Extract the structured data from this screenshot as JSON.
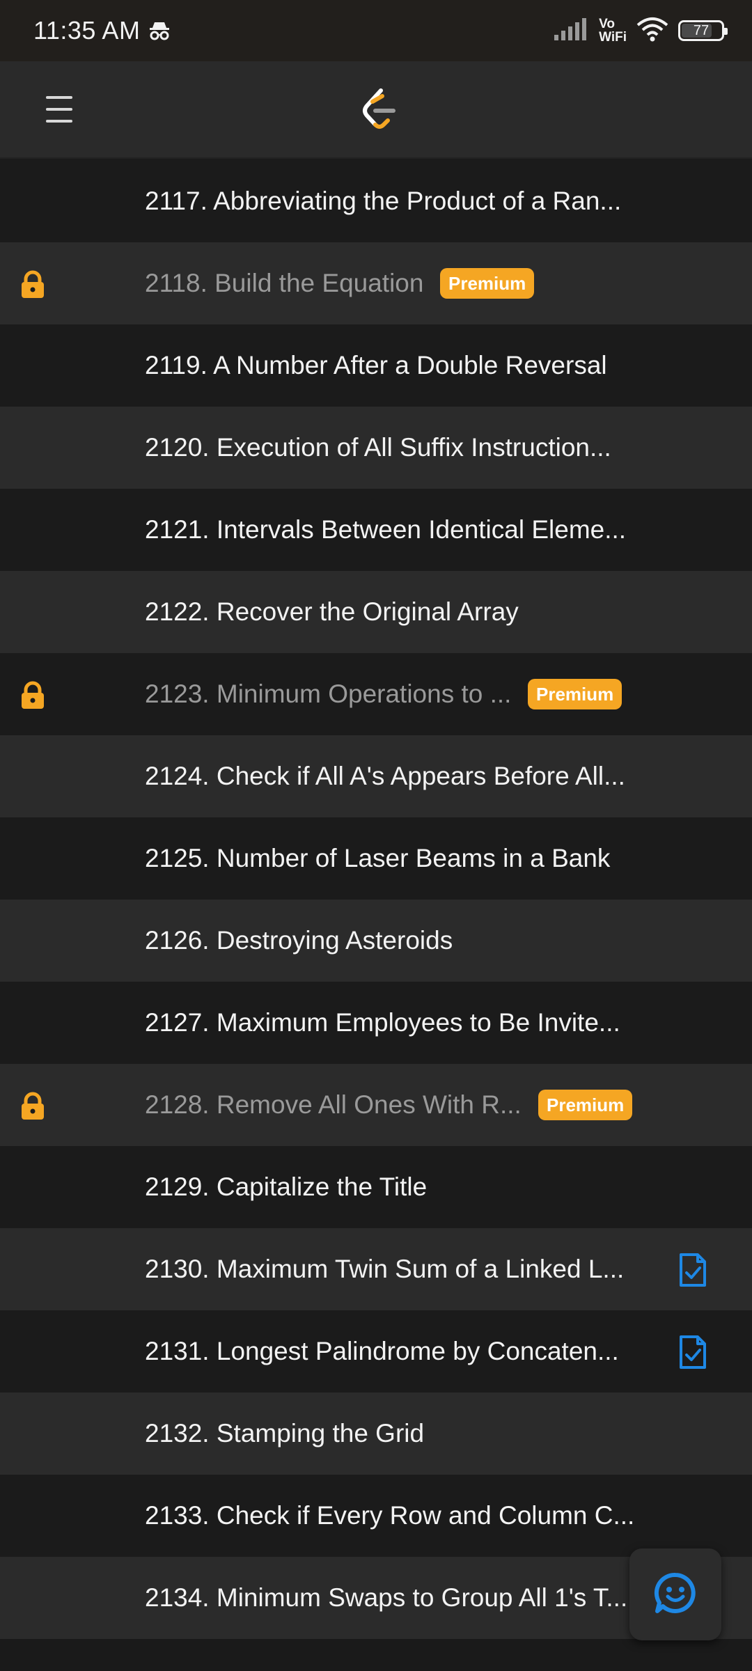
{
  "status_bar": {
    "time": "11:35 AM",
    "vowifi_top": "Vo",
    "vowifi_bottom": "WiFi",
    "battery": "77",
    "battery_level": 0.77,
    "icons": [
      "incognito-icon",
      "signal-icon",
      "wifi-icon",
      "battery-icon"
    ]
  },
  "app_bar": {
    "menu_icon": "hamburger-menu-icon",
    "logo_icon": "leetcode-logo-icon"
  },
  "colors": {
    "premium_badge": "#f5a623",
    "lock": "#f5a623",
    "solution_icon": "#1e88e5",
    "fab_icon": "#1e88e5"
  },
  "problems": [
    {
      "title": "2117. Abbreviating the Product of a Ran...",
      "locked": false,
      "premium": false,
      "solution": false
    },
    {
      "title": "2118. Build the Equation",
      "locked": true,
      "premium": true,
      "badge": "Premium",
      "solution": false
    },
    {
      "title": "2119. A Number After a Double Reversal",
      "locked": false,
      "premium": false,
      "solution": false
    },
    {
      "title": "2120. Execution of All Suffix Instruction...",
      "locked": false,
      "premium": false,
      "solution": false
    },
    {
      "title": "2121. Intervals Between Identical Eleme...",
      "locked": false,
      "premium": false,
      "solution": false
    },
    {
      "title": "2122. Recover the Original Array",
      "locked": false,
      "premium": false,
      "solution": false
    },
    {
      "title": "2123. Minimum Operations to ...",
      "locked": true,
      "premium": true,
      "badge": "Premium",
      "solution": false
    },
    {
      "title": "2124. Check if All A's Appears Before All...",
      "locked": false,
      "premium": false,
      "solution": false
    },
    {
      "title": "2125. Number of Laser Beams in a Bank",
      "locked": false,
      "premium": false,
      "solution": false
    },
    {
      "title": "2126. Destroying Asteroids",
      "locked": false,
      "premium": false,
      "solution": false
    },
    {
      "title": "2127. Maximum Employees to Be Invite...",
      "locked": false,
      "premium": false,
      "solution": false
    },
    {
      "title": "2128. Remove All Ones With R...",
      "locked": true,
      "premium": true,
      "badge": "Premium",
      "solution": false
    },
    {
      "title": "2129. Capitalize the Title",
      "locked": false,
      "premium": false,
      "solution": false
    },
    {
      "title": "2130. Maximum Twin Sum of a Linked L...",
      "locked": false,
      "premium": false,
      "solution": true
    },
    {
      "title": "2131. Longest Palindrome by Concaten...",
      "locked": false,
      "premium": false,
      "solution": true
    },
    {
      "title": "2132. Stamping the Grid",
      "locked": false,
      "premium": false,
      "solution": false
    },
    {
      "title": "2133. Check if Every Row and Column C...",
      "locked": false,
      "premium": false,
      "solution": false
    },
    {
      "title": "2134. Minimum Swaps to Group All 1's T...",
      "locked": false,
      "premium": false,
      "solution": false
    }
  ],
  "fab": {
    "icon": "smiley-chat-icon"
  }
}
